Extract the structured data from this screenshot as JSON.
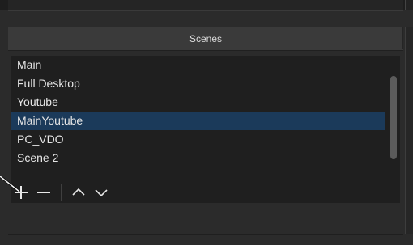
{
  "dock": {
    "title": "Scenes"
  },
  "scenes": [
    {
      "label": "Main",
      "selected": false
    },
    {
      "label": "Full Desktop",
      "selected": false
    },
    {
      "label": "Youtube",
      "selected": false
    },
    {
      "label": "MainYoutube",
      "selected": true
    },
    {
      "label": "PC_VDO",
      "selected": false
    },
    {
      "label": "Scene 2",
      "selected": false
    }
  ],
  "toolbar": {
    "buttons": [
      {
        "name": "add-scene-button",
        "icon": "plus-icon"
      },
      {
        "name": "remove-scene-button",
        "icon": "minus-icon"
      },
      {
        "name": "move-up-button",
        "icon": "chevron-up-icon"
      },
      {
        "name": "move-down-button",
        "icon": "chevron-down-icon"
      }
    ]
  },
  "colors": {
    "background": "#2b2b2b",
    "list_background": "#1f1f1f",
    "selection": "#1b3a5a",
    "text": "#e6e6e6"
  }
}
